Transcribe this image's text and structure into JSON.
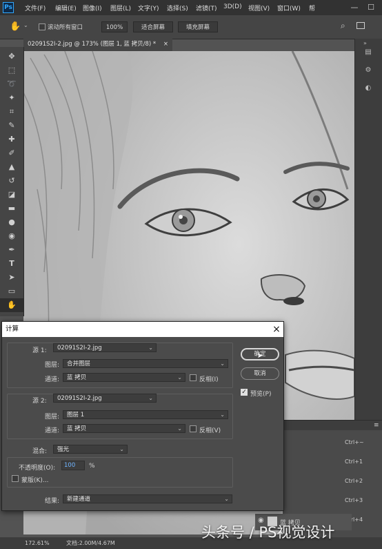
{
  "menubar": {
    "logo": "Ps",
    "items": [
      "文件(F)",
      "编辑(E)",
      "图像(I)",
      "图层(L)",
      "文字(Y)",
      "选择(S)",
      "滤镜(T)",
      "3D(D)",
      "视图(V)",
      "窗口(W)",
      "帮"
    ],
    "window_controls": [
      "—",
      "☐"
    ]
  },
  "options": {
    "scroll_all_label": "滚动所有窗口",
    "zoom_btn": "100%",
    "fit_screen_btn": "适合屏幕",
    "fill_screen_btn": "填充屏幕"
  },
  "document": {
    "tab_title": "02091S2I-2.jpg @ 173% (图层 1, 蓝 拷贝/8) *",
    "tab_close": "×"
  },
  "dialog": {
    "title": "计算",
    "close": "×",
    "source1": {
      "label": "源 1:",
      "file": "02091S2I-2.jpg",
      "layer_label": "图层:",
      "layer": "合并图层",
      "channel_label": "通道:",
      "channel": "蓝 拷贝",
      "invert_label": "反相(I)"
    },
    "source2": {
      "label": "源 2:",
      "file": "02091S2I-2.jpg",
      "layer_label": "图层:",
      "layer": "图层 1",
      "channel_label": "通道:",
      "channel": "蓝 拷贝",
      "invert_label": "反相(V)"
    },
    "blending": {
      "label": "混合:",
      "mode": "强光",
      "opacity_label": "不透明度(O):",
      "opacity": "100",
      "opacity_unit": "%",
      "mask_label": "蒙版(K)..."
    },
    "result": {
      "label": "结果:",
      "value": "新建通道"
    },
    "ok_label": "确定",
    "cancel_label": "取消",
    "preview_label": "预览(P)"
  },
  "channels_panel": {
    "shortcuts": [
      "Ctrl+~",
      "Ctrl+1",
      "Ctrl+2",
      "Ctrl+3",
      "Ctrl+4"
    ],
    "visible_row_label": "蓝 拷贝"
  },
  "statusbar": {
    "zoom": "172.61%",
    "doc_info": "文档:2.00M/4.67M"
  },
  "watermark": "头条号 / PS视觉设计"
}
